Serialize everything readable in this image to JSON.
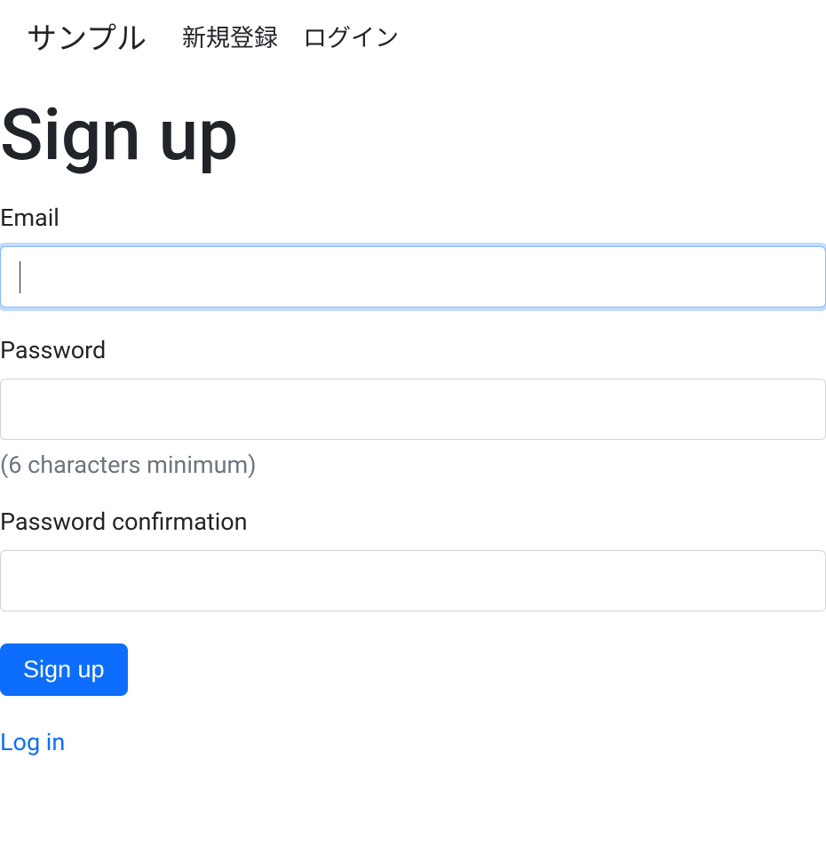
{
  "navbar": {
    "brand": "サンプル",
    "links": [
      {
        "label": "新規登録"
      },
      {
        "label": "ログイン"
      }
    ]
  },
  "page": {
    "title": "Sign up"
  },
  "form": {
    "email": {
      "label": "Email",
      "value": ""
    },
    "password": {
      "label": "Password",
      "value": "",
      "hint": "(6 characters minimum)"
    },
    "password_confirmation": {
      "label": "Password confirmation",
      "value": ""
    },
    "submit_label": "Sign up"
  },
  "links": {
    "login": "Log in"
  }
}
